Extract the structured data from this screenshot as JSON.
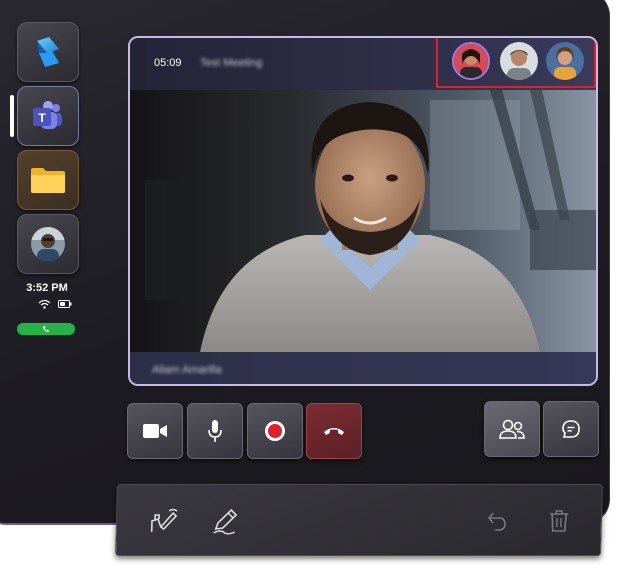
{
  "rail": {
    "apps": [
      {
        "name": "Dynamics 365",
        "icon": "dynamics-logo-icon"
      },
      {
        "name": "Microsoft Teams",
        "icon": "teams-logo-icon",
        "active": true
      },
      {
        "name": "Files",
        "icon": "folder-icon"
      },
      {
        "name": "Contact",
        "icon": "contact-avatar-icon"
      }
    ],
    "time": "3:52 PM",
    "status_icons": [
      "wifi-icon",
      "battery-icon"
    ],
    "call_indicator_icon": "phone-icon"
  },
  "call": {
    "timer": "05:09",
    "meeting_name": "Test Meeting",
    "speaker_name": "Aliam Amarilla",
    "participants_visible": 3
  },
  "controls": {
    "left": [
      "video-camera-icon",
      "microphone-icon",
      "record-icon",
      "hang-up-icon"
    ],
    "right": [
      "participants-icon",
      "chat-icon"
    ]
  },
  "ink_toolbar": {
    "tools": [
      "draw-gesture-icon",
      "pen-icon"
    ],
    "actions": [
      "undo-icon",
      "delete-icon"
    ]
  },
  "colors": {
    "accent_purple": "#9f7ae0",
    "hangup_red": "#7c2d33",
    "record_red": "#e0202a",
    "call_green": "#25b347",
    "roster_highlight": "#e0202a"
  }
}
